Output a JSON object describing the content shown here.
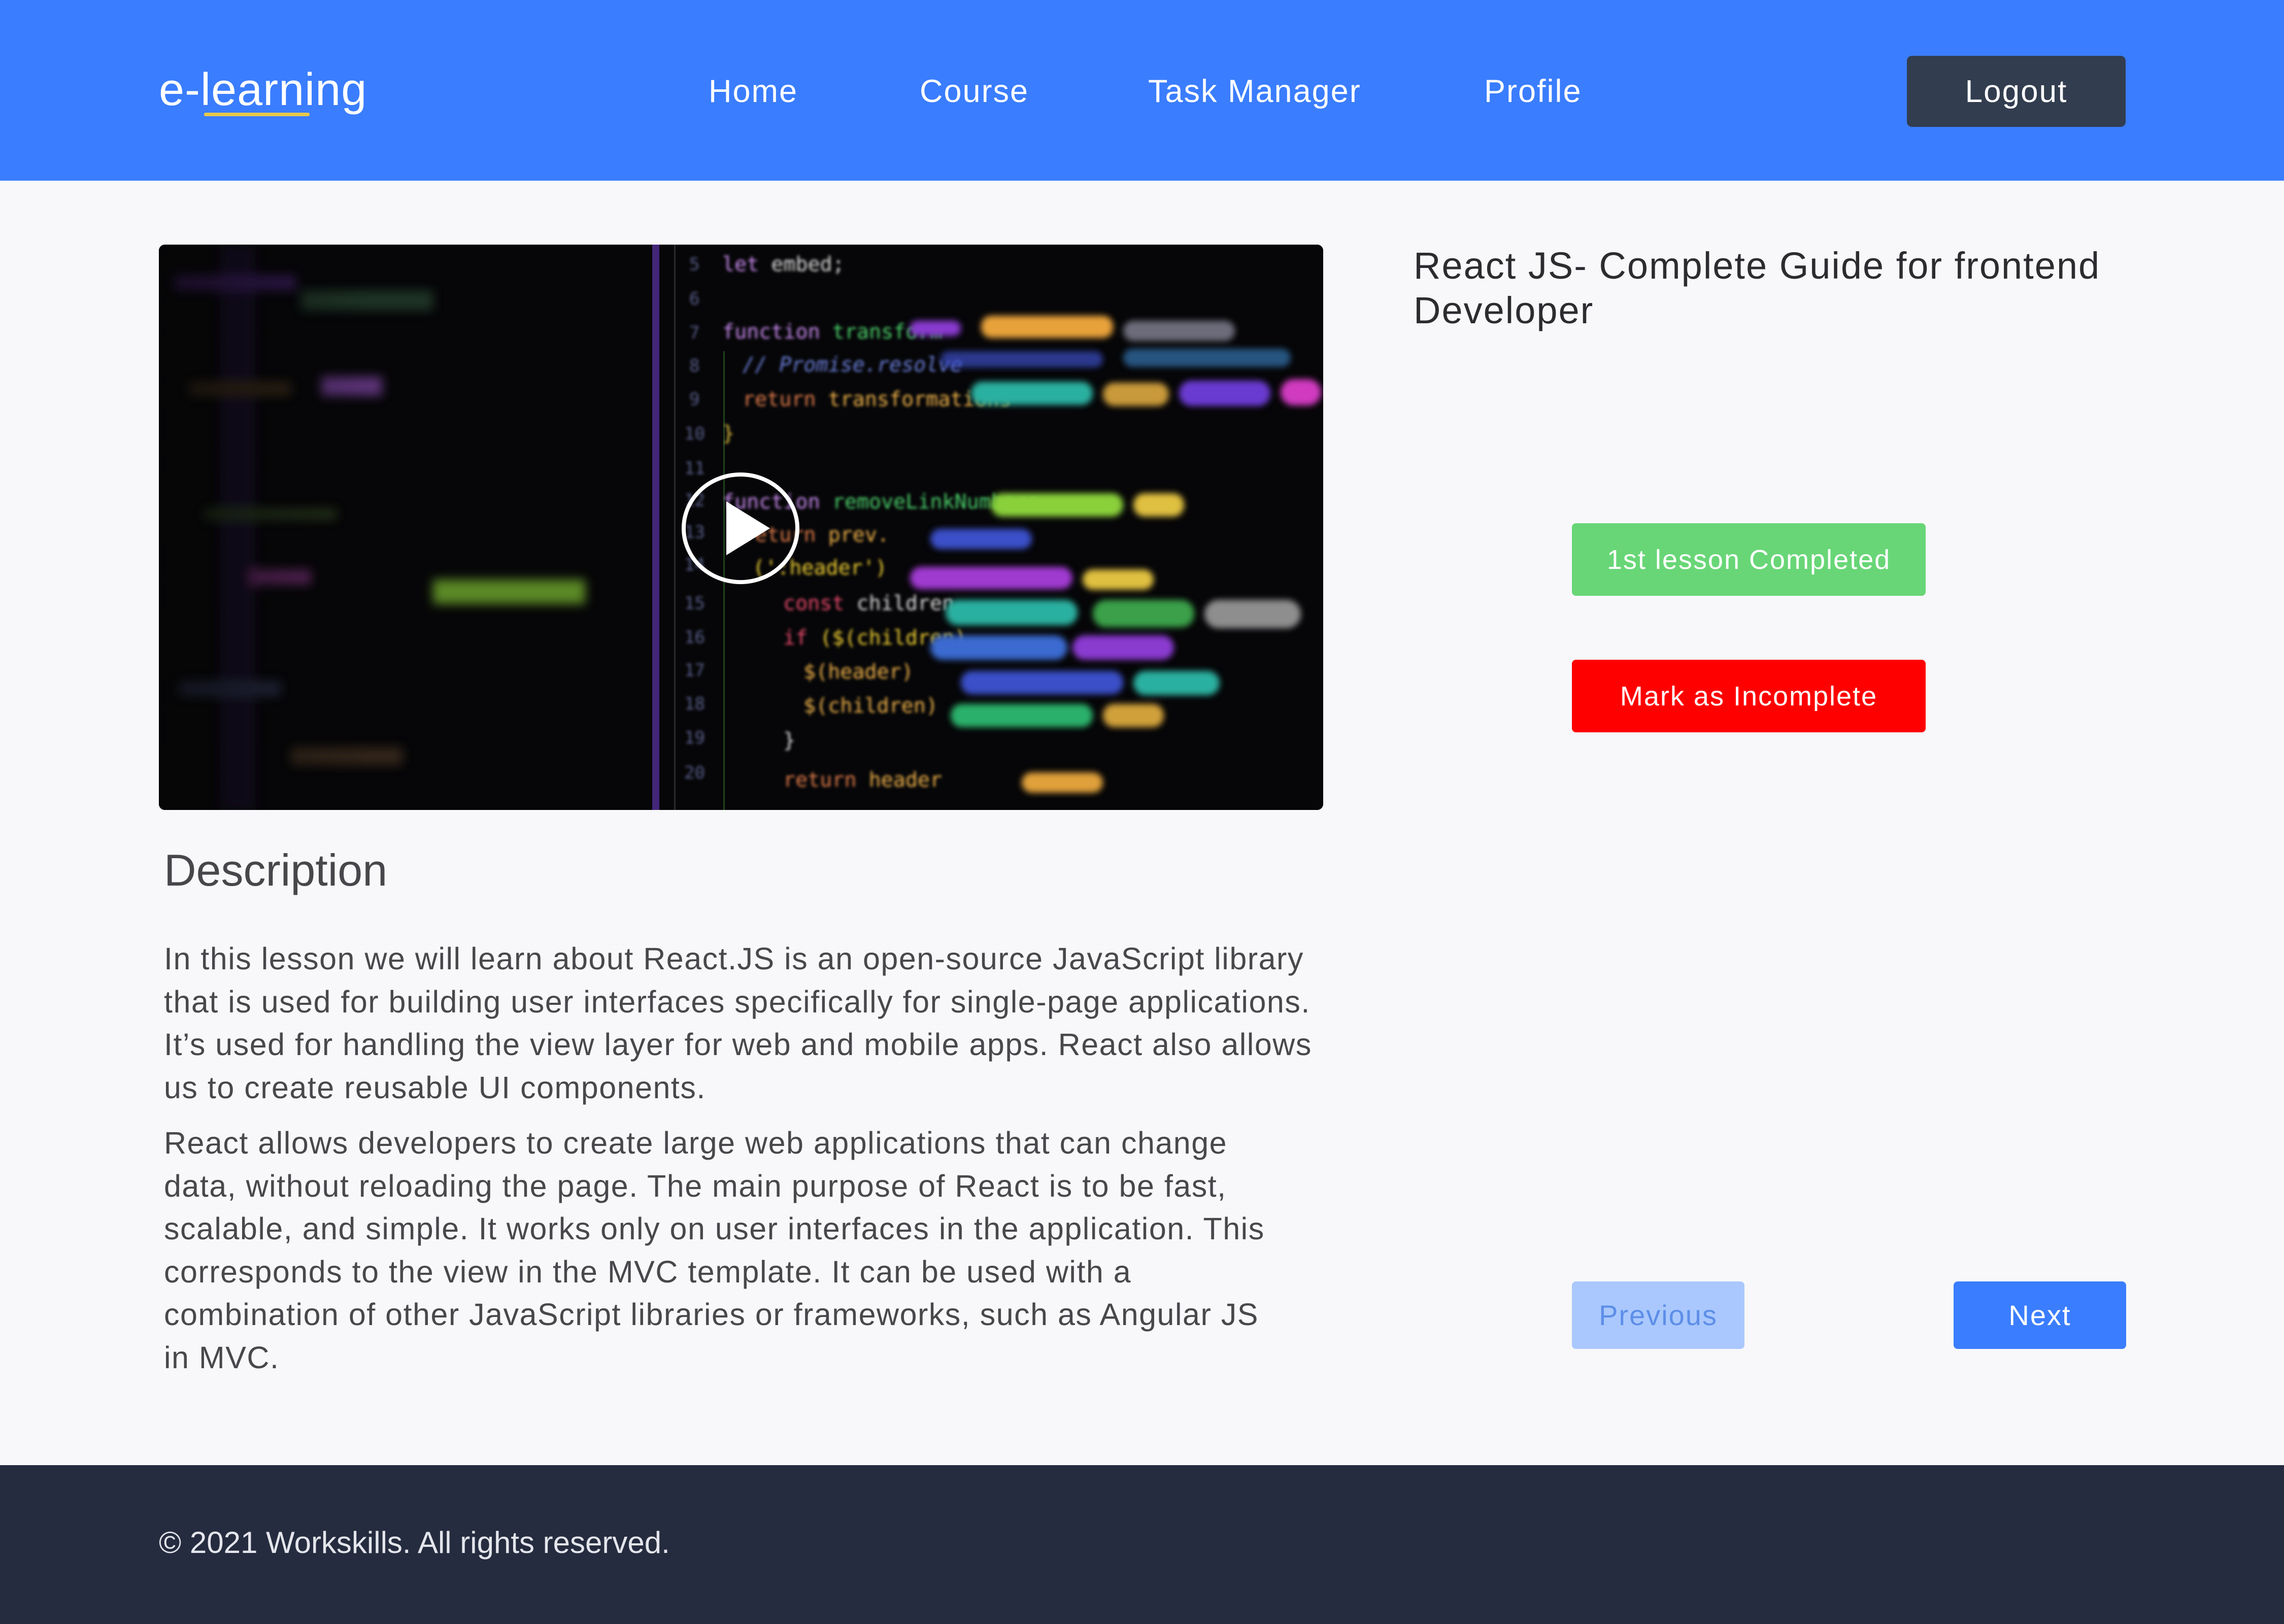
{
  "header": {
    "logo": "e-learning",
    "nav": [
      "Home",
      "Course",
      "Task Manager",
      "Profile"
    ],
    "logout_label": "Logout"
  },
  "lesson": {
    "title": "React JS- Complete Guide for frontend Developer",
    "completed_label": "1st lesson Completed",
    "incomplete_label": "Mark as Incomplete"
  },
  "description": {
    "heading": "Description",
    "paragraphs": [
      "In this lesson we will learn about React.JS is an open-source JavaScript library that is used for building user interfaces specifically for single-page applications. It’s used for handling the view layer for web and mobile apps. React also allows us to create reusable UI components.",
      "React allows developers to create large web applications that can change data, without reloading the page. The main purpose of React is to be fast, scalable, and simple. It works only on user interfaces in the application. This corresponds to the view in the MVC template. It can be used with a combination of other JavaScript libraries or frameworks, such as Angular JS in MVC."
    ]
  },
  "pagination": {
    "previous_label": "Previous",
    "next_label": "Next"
  },
  "footer": {
    "copyright": "© 2021 Workskills. All rights reserved."
  },
  "colors": {
    "brand": "#3a7dfe",
    "logout_bg": "#323d4f",
    "complete": "#68d676",
    "incomplete": "#fe0000",
    "previous_disabled": "#aac8fd",
    "footer_bg": "#252c3f"
  },
  "icons": {
    "video_overlay": "play-icon"
  }
}
